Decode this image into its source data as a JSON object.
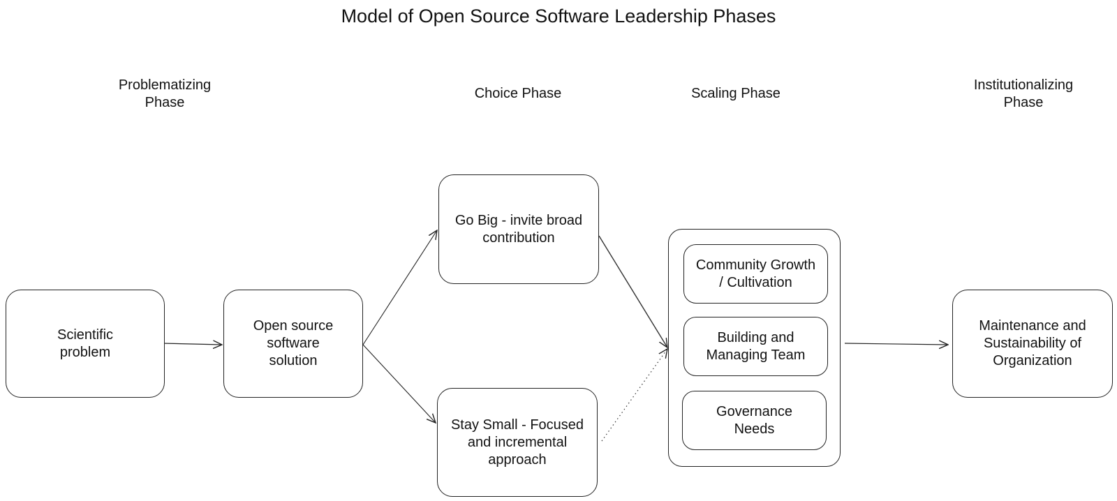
{
  "title": "Model of Open Source Software Leadership Phases",
  "phases": [
    "Problematizing\nPhase",
    "Choice Phase",
    "Scaling Phase",
    "Institutionalizing\nPhase"
  ],
  "nodes": {
    "scientific_problem": "Scientific\nproblem",
    "oss_solution": "Open source\nsoftware\nsolution",
    "go_big": "Go Big - invite broad\ncontribution",
    "stay_small": "Stay Small - Focused\nand incremental\napproach",
    "community_growth": "Community Growth\n/ Cultivation",
    "building_team": "Building and\nManaging Team",
    "governance": "Governance\nNeeds",
    "maintenance": "Maintenance and\nSustainability of\nOrganization"
  },
  "edges": [
    {
      "from": "scientific_problem",
      "to": "oss_solution",
      "style": "solid"
    },
    {
      "from": "oss_solution",
      "to": "go_big",
      "style": "solid"
    },
    {
      "from": "oss_solution",
      "to": "stay_small",
      "style": "solid"
    },
    {
      "from": "go_big",
      "to": "scaling_group",
      "style": "solid"
    },
    {
      "from": "stay_small",
      "to": "scaling_group",
      "style": "dotted"
    },
    {
      "from": "scaling_group",
      "to": "maintenance",
      "style": "solid"
    }
  ]
}
